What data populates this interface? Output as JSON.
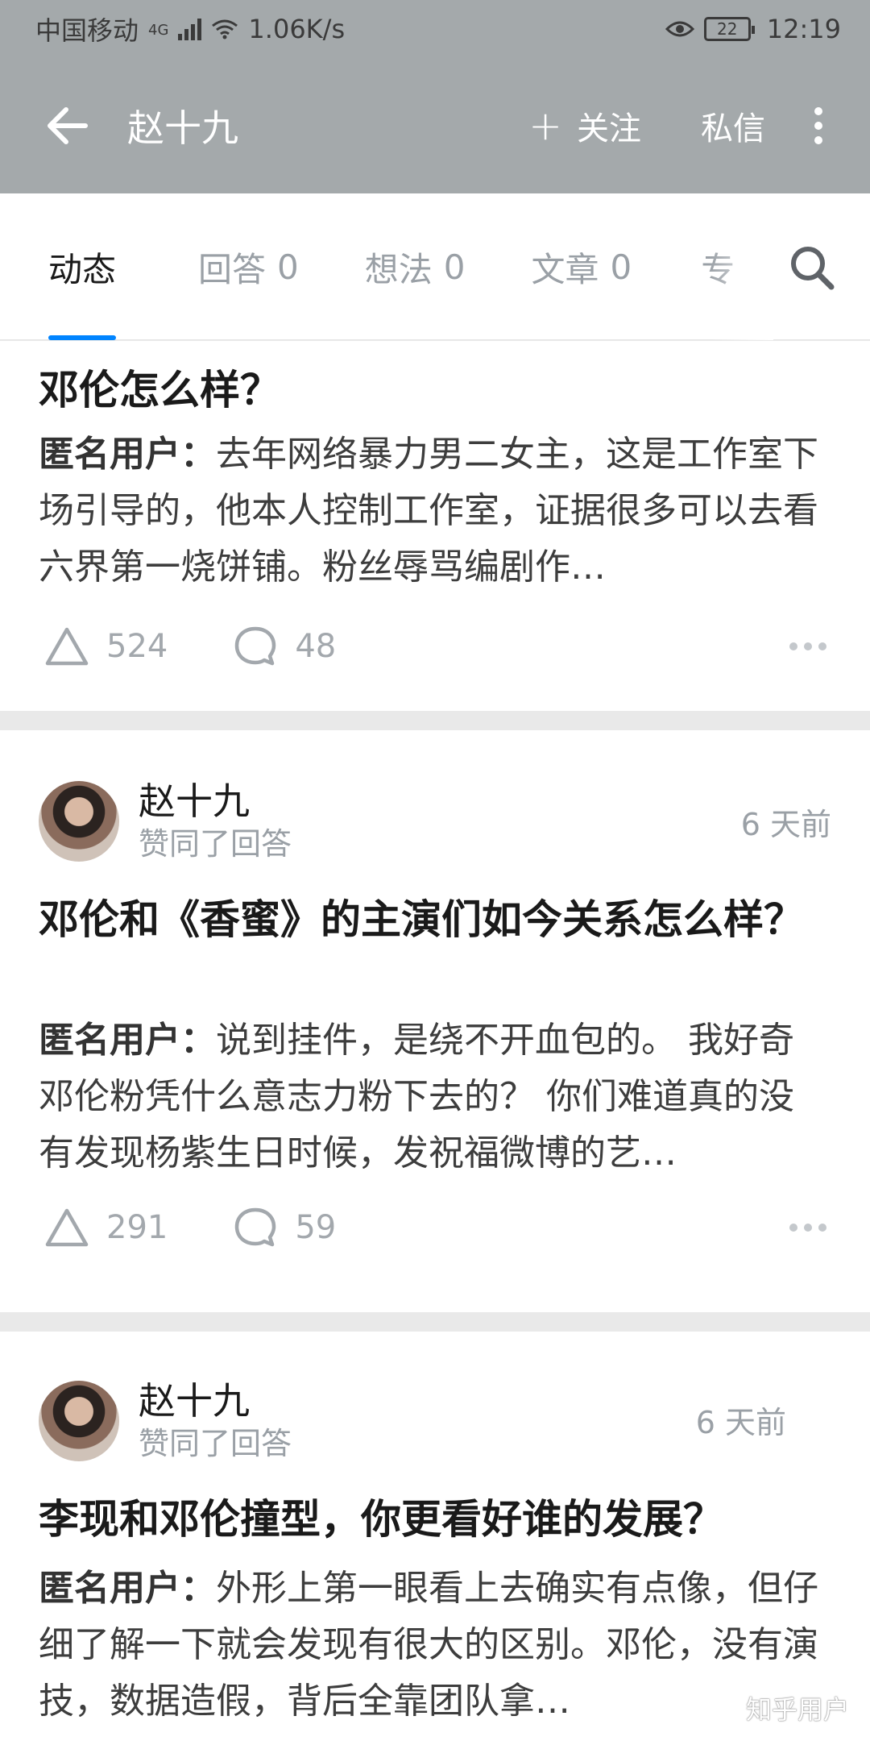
{
  "status_bar": {
    "carrier": "中国移动",
    "network": "4G",
    "speed": "1.06K/s",
    "battery": "22",
    "time": "12:19"
  },
  "header": {
    "title": "赵十九",
    "follow_label": "关注",
    "message_label": "私信"
  },
  "tabs": [
    {
      "label": "动态",
      "count": ""
    },
    {
      "label": "回答",
      "count": "0"
    },
    {
      "label": "想法",
      "count": "0"
    },
    {
      "label": "文章",
      "count": "0"
    },
    {
      "label": "专",
      "count": ""
    }
  ],
  "feed": [
    {
      "question": "邓伦怎么样？",
      "answer_author": "匿名用户：",
      "excerpt": "去年网络暴力男二女主，这是工作室下场引导的，他本人控制工作室，证据很多可以去看六界第一烧饼铺。粉丝辱骂编剧作…",
      "votes": "524",
      "comments": "48"
    },
    {
      "author": "赵十九",
      "action": "赞同了回答",
      "time": "6 天前",
      "question": "邓伦和《香蜜》的主演们如今关系怎么样？",
      "answer_author": "匿名用户：",
      "excerpt": "说到挂件，是绕不开血包的。 我好奇邓伦粉凭什么意志力粉下去的？ 你们难道真的没有发现杨紫生日时候，发祝福微博的艺…",
      "votes": "291",
      "comments": "59"
    },
    {
      "author": "赵十九",
      "action": "赞同了回答",
      "time": "6 天前",
      "question": "李现和邓伦撞型，你更看好谁的发展？",
      "answer_author": "匿名用户：",
      "excerpt": "外形上第一眼看上去确实有点像，但仔细了解一下就会发现有很大的区别。邓伦，没有演技，数据造假，背后全靠团队拿…"
    }
  ],
  "watermark": "知乎用户",
  "colors": {
    "bar": "#a4a9ab",
    "accent": "#0084ff",
    "muted": "#9aa0a6"
  }
}
